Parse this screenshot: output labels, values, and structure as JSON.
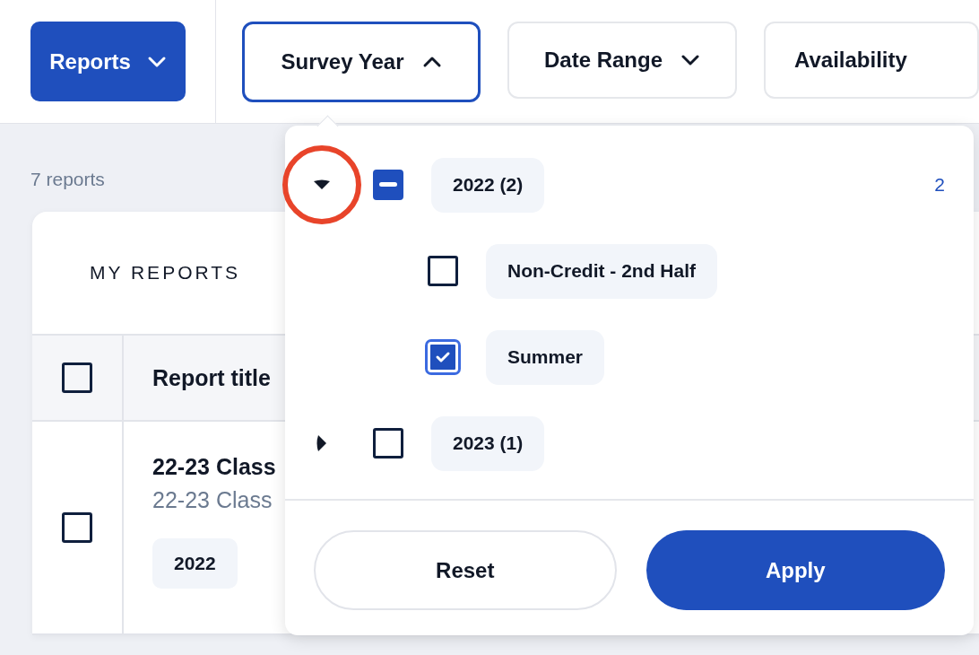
{
  "top_bar": {
    "reports_button": {
      "label": "Reports"
    },
    "filters": [
      {
        "label": "Survey Year",
        "expanded": true
      },
      {
        "label": "Date Range",
        "expanded": false
      },
      {
        "label": "Availability",
        "expanded": false
      }
    ]
  },
  "report_count": "7 reports",
  "card": {
    "title": "MY REPORTS",
    "header": {
      "checked": false,
      "column": "Report title"
    },
    "rows": [
      {
        "checked": false,
        "title": "22-23 Class",
        "subtitle": "22-23 Class",
        "tags": [
          "2022"
        ]
      }
    ]
  },
  "dropdown": {
    "items": [
      {
        "label": "2022 (2)",
        "partial": true,
        "expanded": true,
        "highlighted": true,
        "count": "2",
        "children": [
          {
            "label": "Non-Credit - 2nd Half",
            "checked": false
          },
          {
            "label": "Summer",
            "checked": true
          }
        ]
      },
      {
        "label": "2023 (1)",
        "partial": false,
        "expanded": false,
        "highlighted": false
      }
    ],
    "reset": "Reset",
    "apply": "Apply"
  }
}
